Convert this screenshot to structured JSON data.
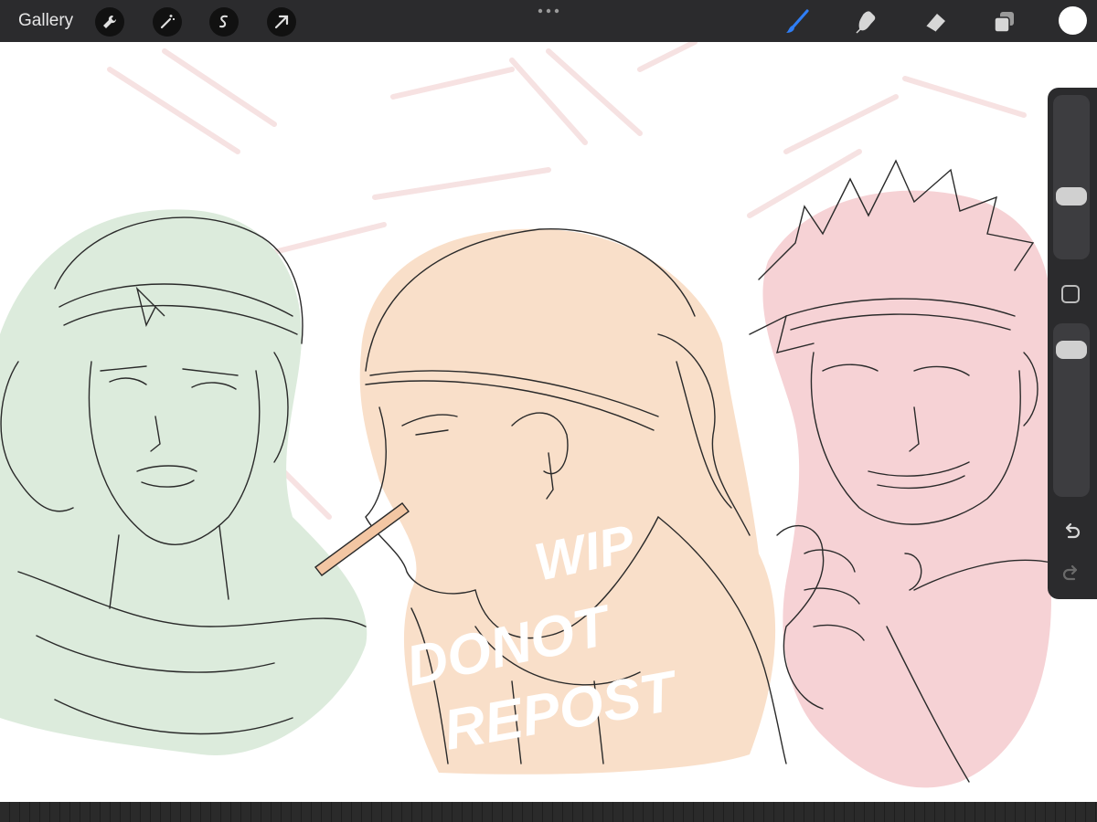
{
  "toolbar": {
    "gallery_label": "Gallery",
    "left_tools": [
      "wrench-icon",
      "magic-wand-icon",
      "selection-icon",
      "transform-arrow-icon"
    ],
    "right_tools": [
      "brush-icon",
      "smudge-icon",
      "eraser-icon",
      "layers-icon"
    ],
    "active_tool": "brush",
    "active_color": "#ffffff",
    "brush_accent": "#2f7ef5"
  },
  "sidebar": {
    "brush_size": 0.36,
    "opacity": 0.08
  },
  "canvas": {
    "watermark_lines": [
      "WIP",
      "DONOT",
      "REPOST"
    ],
    "fill_colors": {
      "left": "#dcebdc",
      "center": "#f9dfc9",
      "right": "#f6d2d5"
    }
  }
}
